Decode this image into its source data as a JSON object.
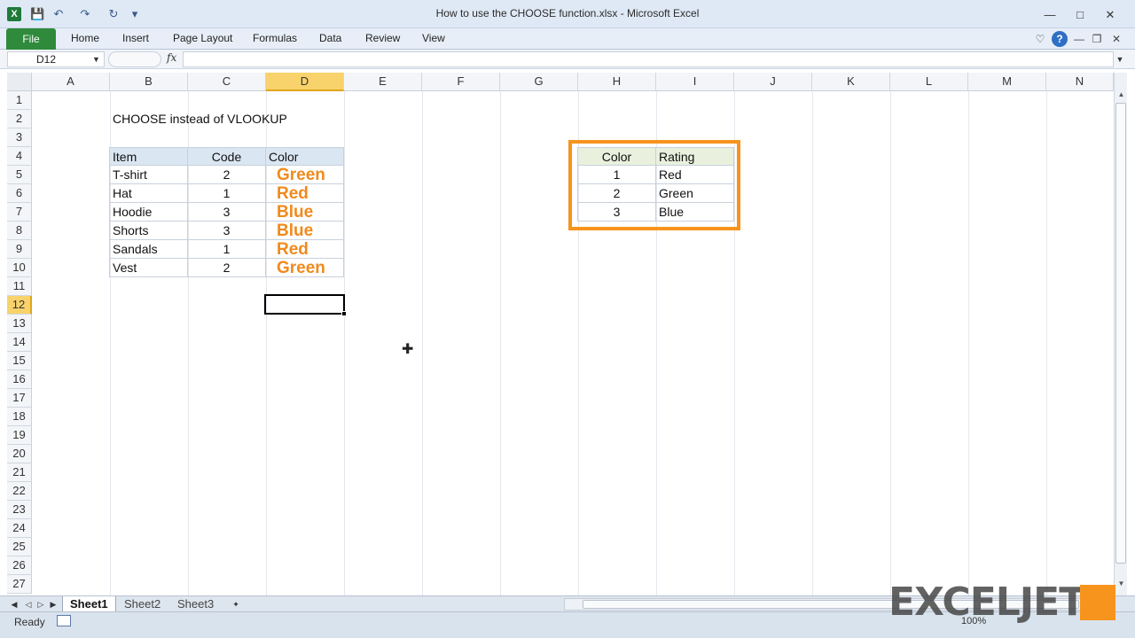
{
  "window": {
    "title": "How to use the CHOOSE function.xlsx - Microsoft Excel",
    "qat": {
      "save_icon": "save-icon",
      "undo_icon": "undo-icon",
      "redo_icon": "redo-icon",
      "repeat_icon": "repeat-icon"
    },
    "controls": {
      "minimize": "—",
      "maximize": "□",
      "close": "✕"
    }
  },
  "ribbon": {
    "file_label": "File",
    "tabs": [
      "Home",
      "Insert",
      "Page Layout",
      "Formulas",
      "Data",
      "Review",
      "View"
    ],
    "accent_color": "#2f8a3c"
  },
  "formula_bar": {
    "name_box": "D12",
    "fx_label": "fx",
    "formula": ""
  },
  "grid": {
    "columns": [
      "A",
      "B",
      "C",
      "D",
      "E",
      "F",
      "G",
      "H",
      "I",
      "J",
      "K",
      "L",
      "M",
      "N"
    ],
    "rows": [
      "1",
      "2",
      "3",
      "4",
      "5",
      "6",
      "7",
      "8",
      "9",
      "10",
      "11",
      "12",
      "13",
      "14",
      "15",
      "16",
      "17",
      "18",
      "19",
      "20",
      "21",
      "22",
      "23",
      "24",
      "25",
      "26",
      "27"
    ],
    "active_column": "D",
    "active_row": "12",
    "selected_cell": "D12"
  },
  "sheet": {
    "heading": "CHOOSE instead of VLOOKUP",
    "main_table": {
      "headers": [
        "Item",
        "Code",
        "Color"
      ],
      "rows": [
        [
          "T-shirt",
          "2",
          "Green"
        ],
        [
          "Hat",
          "1",
          "Red"
        ],
        [
          "Hoodie",
          "3",
          "Blue"
        ],
        [
          "Shorts",
          "3",
          "Blue"
        ],
        [
          "Sandals",
          "1",
          "Red"
        ],
        [
          "Vest",
          "2",
          "Green"
        ]
      ]
    },
    "lookup_table": {
      "headers": [
        "Color",
        "Rating"
      ],
      "rows": [
        [
          "1",
          "Red"
        ],
        [
          "2",
          "Green"
        ],
        [
          "3",
          "Blue"
        ]
      ]
    },
    "highlight_color": "#f7941d"
  },
  "sheet_tabs": [
    "Sheet1",
    "Sheet2",
    "Sheet3"
  ],
  "active_sheet": "Sheet1",
  "status": {
    "ready": "Ready",
    "zoom": "100%"
  },
  "watermark": {
    "text": "EXCELJET"
  }
}
